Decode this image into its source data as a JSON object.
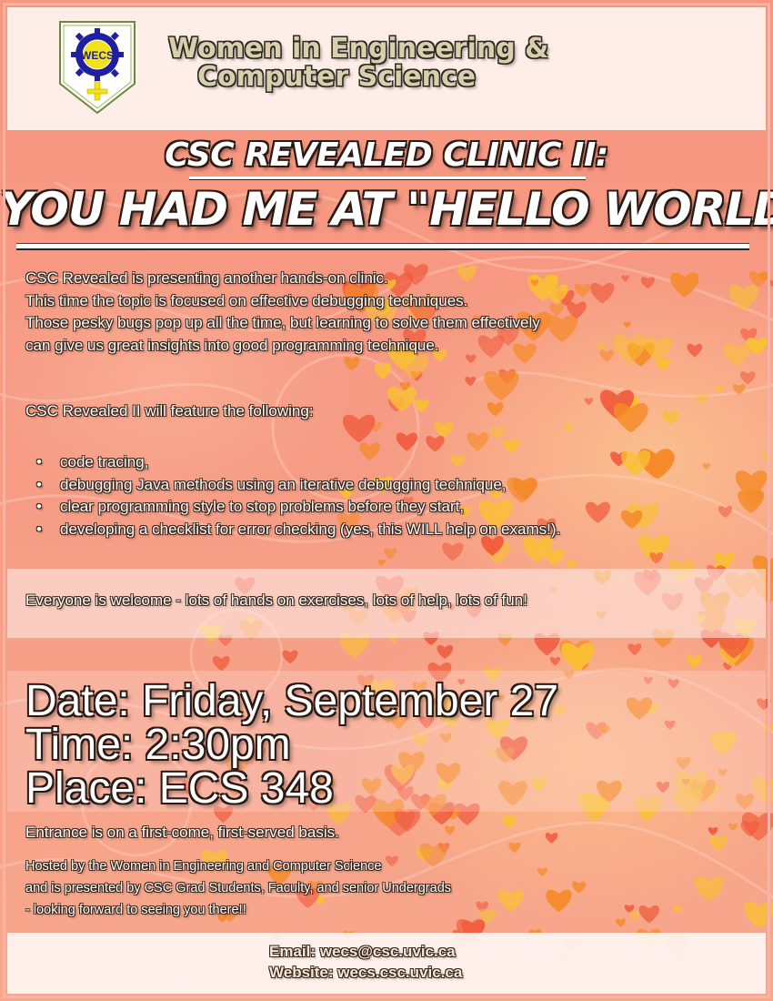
{
  "header": {
    "logo_text": "WECS",
    "org_line1": "Women in Engineering &",
    "org_line2": "Computer Science"
  },
  "event": {
    "subtitle": "CSC REVEALED CLINIC II:",
    "title": "YOU HAD ME AT \"HELLO WORLD\""
  },
  "intro": [
    "CSC Revealed is presenting another hands-on clinic.",
    "This time the topic is focused on effective debugging techniques.",
    "Those pesky bugs pop up all the time, but learning to solve them effectively",
    "can give us great insights into good programming technique."
  ],
  "features_lead": "CSC Revealed II will feature the following:",
  "features": [
    "code tracing,",
    "debugging Java methods using an iterative debugging technique,",
    "clear programming style to stop problems before they start,",
    "developing a checklist for error checking (yes, this WILL help on exams!)."
  ],
  "welcome": "Everyone is welcome - lots of hands on exercises, lots of help, lots of fun!",
  "details": {
    "date": "Date: Friday, September 27",
    "time": "Time: 2:30pm",
    "place": "Place: ECS 348"
  },
  "entrance": "Entrance is on a first-come, first-served basis.",
  "hosted": [
    "Hosted by the Women in Engineering and Computer Science",
    "and is presented by CSC Grad Students, Faculty, and senior Undergrads",
    "- looking forward to seeing you there!!"
  ],
  "contact": {
    "email": "Email: wecs@csc.uvic.ca",
    "website": "Website: wecs.csc.uvic.ca"
  },
  "colors": {
    "background": "#f7957f",
    "heart_red": "#f05a3c",
    "heart_orange": "#f58a2a",
    "heart_gold": "#f9c032",
    "text": "#ffffff",
    "text_outline": "#2a1a14",
    "logo_gear": "#1f1fa0",
    "logo_symbol": "#f2e21c"
  }
}
